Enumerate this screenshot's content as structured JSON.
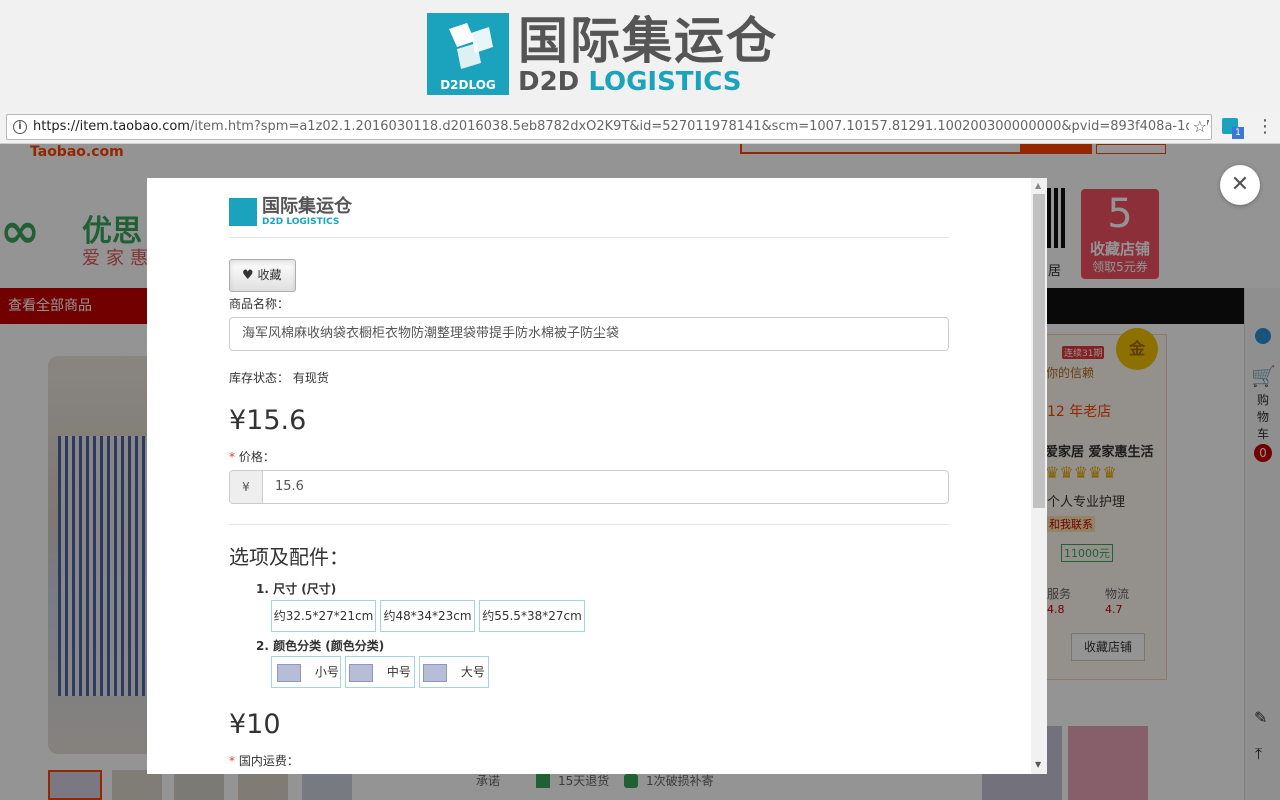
{
  "banner": {
    "logo_mark": "D2DLOG",
    "title_cn": "国际集运仓",
    "title_en_d2d": "D2D",
    "title_en_logistics": "LOGISTICS"
  },
  "browser": {
    "url_host": "https://item.taobao.com",
    "url_rest": "/item.htm?spm=a1z02.1.2016030118.d2016038.5eb8782dxO2K9T&id=527011978141&scm=1007.10157.81291.100200300000000&pvid=893f408a-1d87-4ffd-8...",
    "ext_badge": "1"
  },
  "background_page": {
    "site_logo": "Taobao.com",
    "shop_name_part": "优思",
    "shop_slogan_part": "爱家惠",
    "view_all": "查看全部商品",
    "coupon_value": "5",
    "coupon_label": "收藏店铺",
    "coupon_sub": "领取5元券",
    "qr_caption": "居",
    "seal": "金",
    "badge_streak": "连续31期",
    "trust_text": "你的信赖",
    "shop_age": "12 年老店",
    "shop_brand": "爱家居 爱家惠生活",
    "care_text": "个人专业护理",
    "contact_text": "和我联系",
    "deposit_text": "11000元",
    "col_service": "服务",
    "col_logistics": "物流",
    "score_service": "4.8",
    "score_logistics": "4.7",
    "fav_shop_btn": "收藏店铺",
    "promise_label": "承诺",
    "promise_1": "15天退货",
    "promise_2": "1次破损补寄",
    "cart_label": "购物车",
    "cart_count": "0"
  },
  "modal": {
    "logo_cn": "国际集运仓",
    "logo_en": "D2D LOGISTICS",
    "fav_button": "收藏",
    "name_label": "商品名称：",
    "name_value": "海军风棉麻收纳袋衣橱柜衣物防潮整理袋带提手防水棉被子防尘袋",
    "stock_label": "库存状态：",
    "stock_value": "有现货",
    "price_big": "¥15.6",
    "required_mark": "*",
    "price_label": "价格：",
    "currency_addon": "¥",
    "price_value": "15.6",
    "options_title": "选项及配件：",
    "option1_title": "1. 尺寸 (尺寸)",
    "option1_values": [
      "约32.5*27*21cm",
      "约48*34*23cm",
      "约55.5*38*27cm"
    ],
    "option2_title": "2. 颜色分类 (颜色分类)",
    "option2_values": [
      "小号",
      "中号",
      "大号"
    ],
    "shipping_big": "¥10",
    "shipping_label": "国内运费："
  },
  "colors": {
    "brand_teal": "#1ba3bd",
    "taobao_orange": "#ff4400",
    "shop_red": "#c40000",
    "required_red": "#e4393c"
  }
}
